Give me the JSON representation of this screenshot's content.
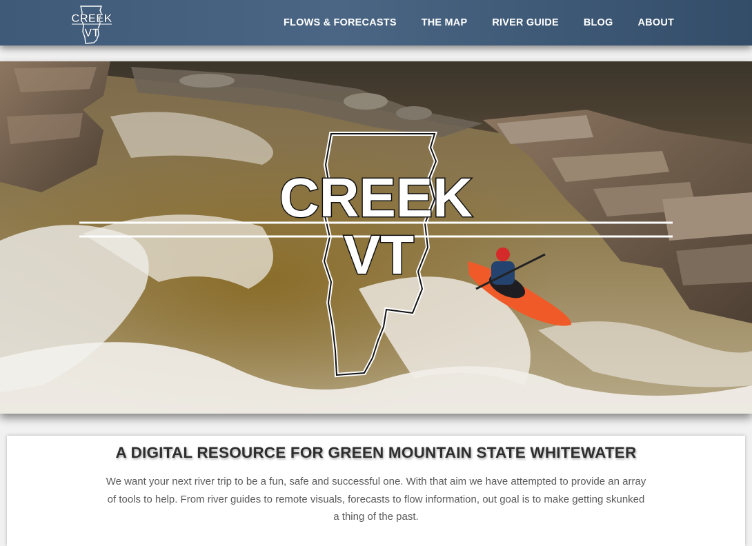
{
  "brand": {
    "logo_line1": "CREEK",
    "logo_line2": "VT"
  },
  "nav": {
    "items": [
      {
        "label": "FLOWS & FORECASTS"
      },
      {
        "label": "THE MAP"
      },
      {
        "label": "RIVER GUIDE"
      },
      {
        "label": "BLOG"
      },
      {
        "label": "ABOUT"
      }
    ]
  },
  "hero": {
    "logo_line1": "CREEK",
    "logo_line2": "VT"
  },
  "intro": {
    "heading": "A DIGITAL RESOURCE FOR GREEN MOUNTAIN STATE WHITEWATER",
    "body": "We want your next river trip to be a fun, safe and successful one.  With that aim we have attempted to provide an array of tools to help.  From river guides to remote visuals, forecasts to flow information, out goal is to make getting skunked a thing of the past."
  },
  "colors": {
    "nav_bar": "#445f7d",
    "kayak": "#f05a28",
    "helmet": "#d42a2a"
  }
}
